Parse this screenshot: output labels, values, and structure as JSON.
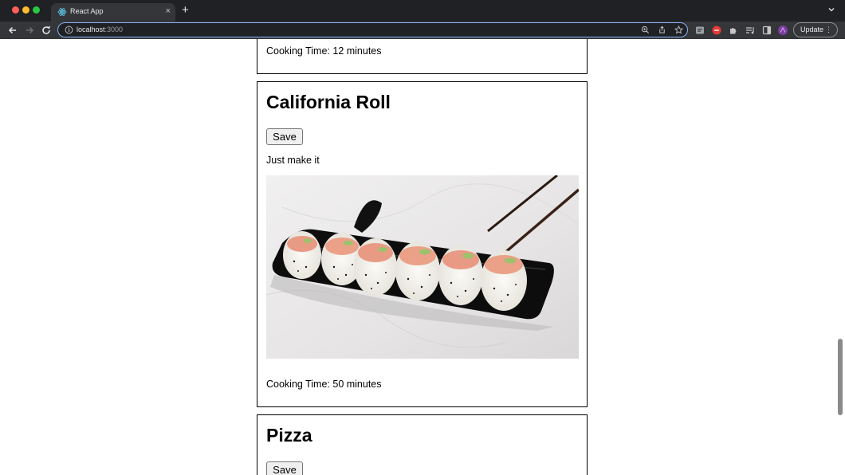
{
  "browser": {
    "tab_title": "React App",
    "tab_close": "×",
    "new_tab": "+",
    "url_host": "localhost",
    "url_port": ":3000",
    "update_label": "Update",
    "update_menu": "⋮"
  },
  "recipes": [
    {
      "cooking_time": "Cooking Time: 12 minutes"
    },
    {
      "name": "California Roll",
      "save_label": "Save",
      "description": "Just make it",
      "image": "california-roll-photo",
      "cooking_time": "Cooking Time: 50 minutes"
    },
    {
      "name": "Pizza",
      "save_label": "Save"
    }
  ],
  "colors": {
    "chrome_dark": "#202124",
    "chrome_tab": "#35363a",
    "focus_ring": "#8ab4f8"
  }
}
